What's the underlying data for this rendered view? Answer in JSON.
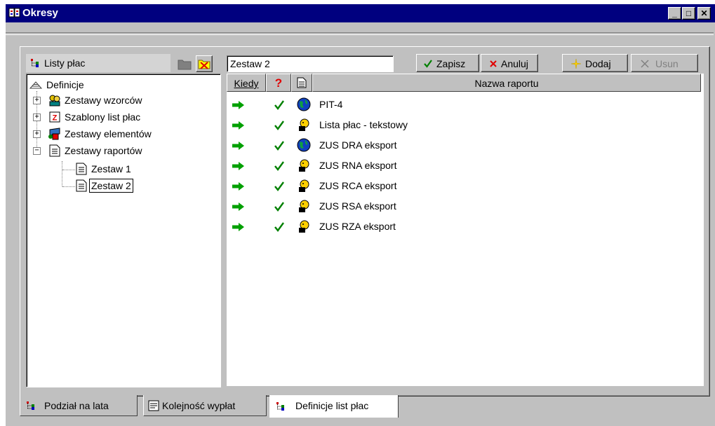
{
  "window": {
    "title": "Okresy",
    "controls": {
      "minimize": "_",
      "maximize": "□",
      "close": "✕"
    }
  },
  "tree_panel": {
    "header_label": "Listy płac",
    "header_icon": "payroll-list-icon",
    "tree": {
      "root": {
        "label": "Definicje",
        "icon": "definitions-icon"
      },
      "items": [
        {
          "label": "Zestawy wzorców",
          "icon": "people-icon",
          "expander": "+"
        },
        {
          "label": "Szablony list płac",
          "icon": "template-icon",
          "expander": "+"
        },
        {
          "label": "Zestawy elementów",
          "icon": "elements-icon",
          "expander": "+"
        },
        {
          "label": "Zestawy raportów",
          "icon": "report-icon",
          "expander": "−"
        }
      ],
      "children": [
        {
          "label": "Zestaw 1",
          "icon": "report-icon"
        },
        {
          "label": "Zestaw 2",
          "icon": "report-icon",
          "selected": true
        }
      ]
    }
  },
  "editor": {
    "name_value": "Zestaw 2",
    "buttons": {
      "save": "Zapisz",
      "cancel": "Anuluj",
      "add": "Dodaj",
      "remove": "Usun"
    }
  },
  "grid": {
    "columns": {
      "when": "Kiedy",
      "question": "?",
      "doc": "report-icon",
      "name": "Nazwa raportu"
    },
    "rows": [
      {
        "icon": "globe-icon",
        "name": "PIT-4"
      },
      {
        "icon": "person-icon",
        "name": "Lista płac - tekstowy"
      },
      {
        "icon": "globe-icon",
        "name": "ZUS DRA eksport"
      },
      {
        "icon": "person-icon",
        "name": "ZUS RNA eksport"
      },
      {
        "icon": "person-icon",
        "name": "ZUS RCA eksport"
      },
      {
        "icon": "person-icon",
        "name": "ZUS RSA eksport"
      },
      {
        "icon": "person-icon",
        "name": "ZUS RZA eksport"
      }
    ]
  },
  "tabs": [
    {
      "label": "Podział na lata",
      "icon": "payroll-list-icon",
      "active": false
    },
    {
      "label": "Kolejność wypłat",
      "icon": "list-icon",
      "active": false
    },
    {
      "label": "Definicje list płac",
      "icon": "payroll-list-icon",
      "active": true
    }
  ],
  "colors": {
    "titlebar": "#00007f",
    "window_bg": "#c0c0c0",
    "arrow_green": "#00a000",
    "check_green": "#008000",
    "cancel_red": "#e00000",
    "selection_border": "#000000"
  }
}
